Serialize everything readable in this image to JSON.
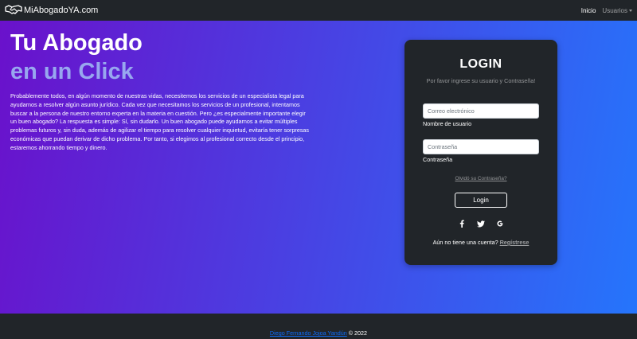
{
  "nav": {
    "brand": "MiAbogadoYA.com",
    "links": [
      {
        "label": "Inicio"
      },
      {
        "label": "Usuarios"
      }
    ]
  },
  "hero": {
    "title_line1": "Tu Abogado",
    "title_line2": "en un Click",
    "paragraph": "Probablemente todos, en algún momento de nuestras vidas, necesitemos los servicios de un especialista legal para ayudarnos a resolver algún asunto jurídico. Cada vez que necesitamos los servicios de un profesional, intentamos buscar a la persona de nuestro entorno experta en la materia en cuestión. Pero ¿es especialmente importante elegir un buen abogado? La respuesta es simple: Sí, sin dudarlo. Un buen abogado puede ayudarnos a evitar múltiples problemas futuros y, sin duda, además de agilizar el tiempo para resolver cualquier inquietud, evitaría tener sorpresas económicas que puedan derivar de dicho problema. Por tanto, si elegimos al profesional correcto desde el principio, estaremos ahorrando tiempo y dinero."
  },
  "login": {
    "title": "LOGIN",
    "subtitle": "Por favor ingrese su usuario y Contraseña!",
    "email_placeholder": "Correo electrónico",
    "email_label": "Nombre de usuario",
    "password_placeholder": "Contraseña",
    "password_label": "Contraseña",
    "forgot": "Olvidó su Contraseña?",
    "button": "Login",
    "social_icons": [
      "facebook-icon",
      "twitter-icon",
      "google-icon"
    ],
    "signup_prompt": "Aún no tiene una cuenta?",
    "signup_link": "Regístrese"
  },
  "footer": {
    "author": "Diego Fernando Jojoa Yandún",
    "copyright": "© 2022"
  },
  "colors": {
    "gradient_start": "#6a11cb",
    "gradient_end": "#2575fc",
    "dark": "#212529",
    "title_accent": "#98a7ef",
    "link": "#0d6efd"
  }
}
